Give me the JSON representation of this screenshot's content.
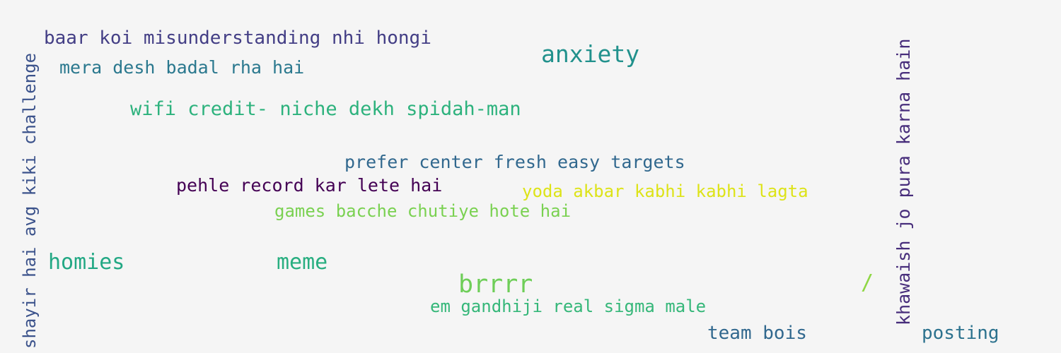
{
  "words": [
    {
      "text": "baar koi misunderstanding nhi hongi",
      "color": "#433e85"
    },
    {
      "text": "mera desh badal rha hai",
      "color": "#2a788e"
    },
    {
      "text": "anxiety",
      "color": "#21918c"
    },
    {
      "text": "wifi credit- niche dekh spidah-man",
      "color": "#2db27d"
    },
    {
      "text": "prefer center fresh easy targets",
      "color": "#31688e"
    },
    {
      "text": "pehle record kar lete hai",
      "color": "#440154"
    },
    {
      "text": "yoda akbar kabhi kabhi lagta",
      "color": "#dde318"
    },
    {
      "text": "games bacche chutiye hote hai",
      "color": "#7ad151"
    },
    {
      "text": "homies",
      "color": "#22a884"
    },
    {
      "text": "meme",
      "color": "#28ae80"
    },
    {
      "text": "brrrr",
      "color": "#6ece58"
    },
    {
      "text": "/",
      "color": "#8fd744"
    },
    {
      "text": "em gandhiji real sigma male",
      "color": "#35b779"
    },
    {
      "text": "team bois",
      "color": "#31688e"
    },
    {
      "text": "posting",
      "color": "#2c728e"
    },
    {
      "text": "shayir hai avg kiki challenge",
      "color": "#3b528b"
    },
    {
      "text": "khawaish jo pura karna hain",
      "color": "#472d7b"
    }
  ]
}
